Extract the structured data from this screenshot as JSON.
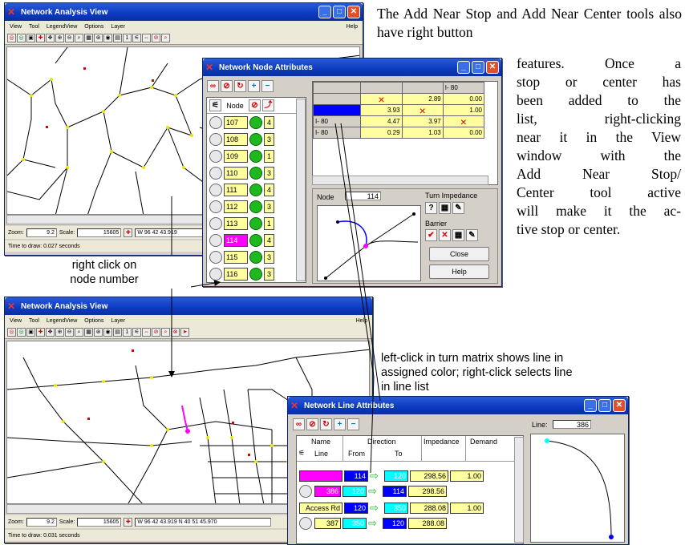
{
  "window1": {
    "title": "Network Analysis View",
    "menu": [
      "View",
      "Tool",
      "LegendView",
      "Options",
      "Layer"
    ],
    "help": "Help",
    "zoom_label": "Zoom:",
    "zoom": "9.2",
    "scale_label": "Scale:",
    "scale": "15605",
    "coords": "W 96 42 43.919",
    "status": "Time to draw: 0.027 seconds"
  },
  "window2": {
    "title": "Network Analysis View",
    "menu": [
      "View",
      "Tool",
      "LegendView",
      "Options",
      "Layer"
    ],
    "help": "Help",
    "zoom_label": "Zoom:",
    "zoom": "9.2",
    "scale_label": "Scale:",
    "scale": "15605",
    "coords": "W 96 42 43.919  N 40 51 45.970",
    "status": "Time to draw: 0.031 seconds"
  },
  "node_dialog": {
    "title": "Network Node Attributes",
    "node_header": "Node",
    "nodes": [
      {
        "num": "107",
        "count": "4"
      },
      {
        "num": "108",
        "count": "3"
      },
      {
        "num": "109",
        "count": "1"
      },
      {
        "num": "110",
        "count": "3"
      },
      {
        "num": "111",
        "count": "4"
      },
      {
        "num": "112",
        "count": "3"
      },
      {
        "num": "113",
        "count": "1"
      },
      {
        "num": "114",
        "count": "4"
      },
      {
        "num": "115",
        "count": "3"
      },
      {
        "num": "116",
        "count": "3"
      }
    ],
    "matrix": [
      [
        "",
        "",
        "",
        "I- 80"
      ],
      [
        "",
        "×",
        "2.89",
        "0.00"
      ],
      [
        "",
        "3.93",
        "×",
        "1.00"
      ],
      [
        "I- 80",
        "4.47",
        "3.97",
        "×"
      ],
      [
        "I- 80",
        "0.29",
        "1.03",
        "0.00"
      ]
    ],
    "node_label": "Node",
    "node_value": "114",
    "turn_impedance": "Turn Impedance",
    "barrier": "Barrier",
    "close": "Close",
    "help": "Help"
  },
  "line_dialog": {
    "title": "Network Line Attributes",
    "line_label": "Line:",
    "line_value": "386",
    "headers": {
      "name": "Name",
      "line": "Line",
      "direction": "Direction",
      "from": "From",
      "to": "To",
      "impedance": "Impedance",
      "demand": "Demand"
    },
    "rows": [
      {
        "name": "",
        "from": "114",
        "to": "120",
        "impedance": "298.56",
        "demand": "1.00",
        "line": "386",
        "from2": "120",
        "to2": "114",
        "impedance2": "298.56"
      },
      {
        "name": "Access Rd",
        "from": "120",
        "to": "350",
        "impedance": "288.08",
        "demand": "1.00",
        "line": "387",
        "from2": "350",
        "to2": "120",
        "impedance2": "288.08"
      }
    ]
  },
  "text": {
    "paragraph_first": "The Add Near Stop and Add Near Center tools also have right button",
    "paragraph_rest": [
      "features. Once a",
      "stop or center has",
      "been added to the",
      "list, right-clicking",
      "near it in the View",
      "window with the",
      "Add Near Stop/",
      "Center tool active",
      "will make it the ac-",
      "tive stop or center."
    ],
    "callout_right_click": [
      "right click on",
      "node number"
    ],
    "callout_left_click": [
      "left-click in turn matrix shows line in",
      "assigned color; right-click selects line",
      "in line list"
    ]
  },
  "colors": {
    "magenta": "#ff00ff",
    "blue": "#0000ff",
    "cyan": "#00ffff",
    "yellow": "#ffffa0",
    "green": "#1fb91f"
  }
}
